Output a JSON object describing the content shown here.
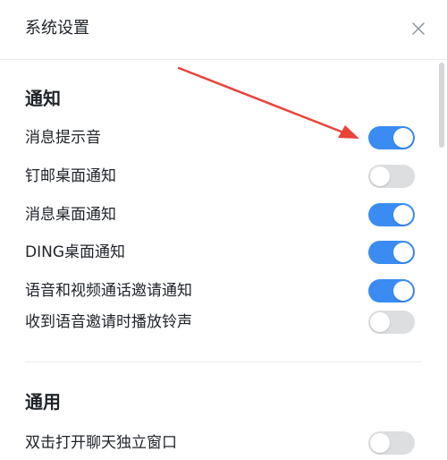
{
  "dialog": {
    "title": "系统设置",
    "close_icon": "close-icon"
  },
  "sections": [
    {
      "title": "通知",
      "items": [
        {
          "label": "消息提示音",
          "enabled": true
        },
        {
          "label": "钉邮桌面通知",
          "enabled": false
        },
        {
          "label": "消息桌面通知",
          "enabled": true
        },
        {
          "label": "DING桌面通知",
          "enabled": true
        },
        {
          "label": "语音和视频通话邀请通知",
          "enabled": true
        },
        {
          "label": "收到语音邀请时播放铃声",
          "enabled": false
        }
      ]
    },
    {
      "title": "通用",
      "items": [
        {
          "label": "双击打开聊天独立窗口",
          "enabled": false
        }
      ]
    }
  ],
  "colors": {
    "toggle_on": "#3a8cf3",
    "toggle_off": "#dcdee0",
    "annotation_arrow": "#e8443a"
  }
}
